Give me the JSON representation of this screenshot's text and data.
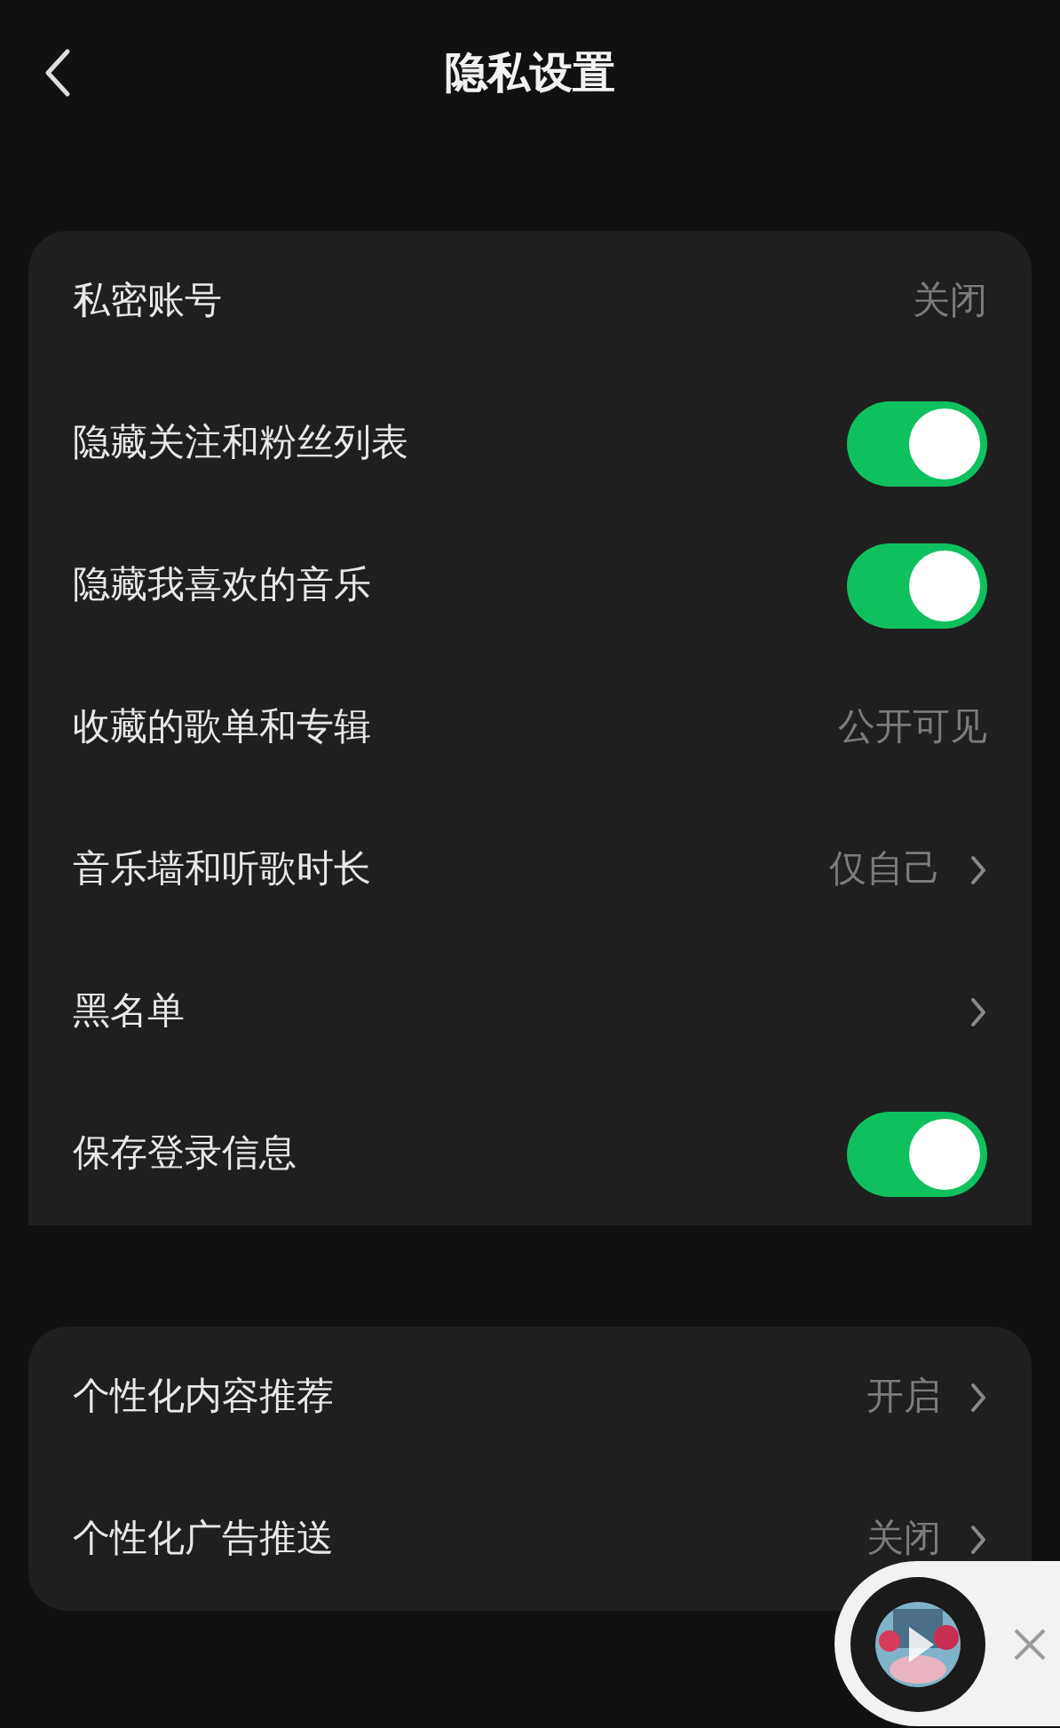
{
  "header": {
    "title": "隐私设置"
  },
  "sections": [
    {
      "items": [
        {
          "kind": "value",
          "label": "私密账号",
          "value": "关闭"
        },
        {
          "kind": "toggle",
          "label": "隐藏关注和粉丝列表",
          "on": true
        },
        {
          "kind": "toggle",
          "label": "隐藏我喜欢的音乐",
          "on": true
        },
        {
          "kind": "value",
          "label": "收藏的歌单和专辑",
          "value": "公开可见"
        },
        {
          "kind": "nav",
          "label": "音乐墙和听歌时长",
          "value": "仅自己"
        },
        {
          "kind": "nav",
          "label": "黑名单"
        },
        {
          "kind": "toggle",
          "label": "保存登录信息",
          "on": true
        }
      ]
    },
    {
      "items": [
        {
          "kind": "nav",
          "label": "个性化内容推荐",
          "value": "开启"
        },
        {
          "kind": "nav",
          "label": "个性化广告推送",
          "value": "关闭"
        }
      ]
    }
  ]
}
